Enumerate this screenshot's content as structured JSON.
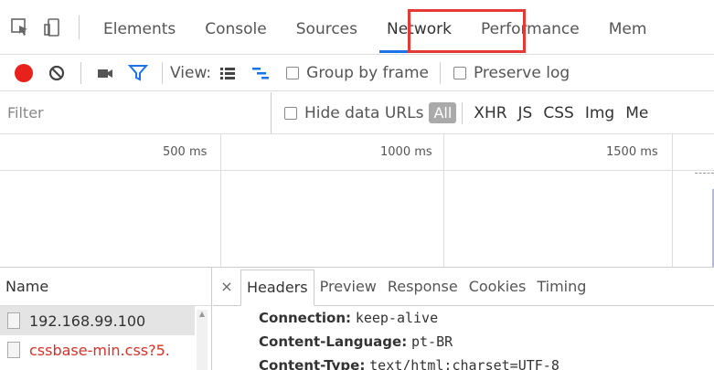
{
  "tabs": [
    "Elements",
    "Console",
    "Sources",
    "Network",
    "Performance",
    "Mem"
  ],
  "toolbar": {
    "view_label": "View:",
    "group_by_frame": "Group by frame",
    "preserve_log": "Preserve log"
  },
  "filterbar": {
    "filter_placeholder": "Filter",
    "hide_data_urls": "Hide data URLs",
    "all_label": "All",
    "types": [
      "XHR",
      "JS",
      "CSS",
      "Img",
      "Me"
    ]
  },
  "timeline": {
    "ticks": [
      "500 ms",
      "1000 ms",
      "1500 ms"
    ]
  },
  "requests": {
    "header": "Name",
    "items": [
      "192.168.99.100",
      "cssbase-min.css?5."
    ]
  },
  "details": {
    "close_label": "×",
    "tabs": [
      "Headers",
      "Preview",
      "Response",
      "Cookies",
      "Timing"
    ],
    "headers": [
      {
        "key": "Connection:",
        "value": "keep-alive"
      },
      {
        "key": "Content-Language:",
        "value": "pt-BR"
      },
      {
        "key": "Content-Type:",
        "value": "text/html;charset=UTF-8"
      }
    ]
  },
  "colors": {
    "accent": "#1a73e8",
    "highlight": "#e53935",
    "record": "#e8211c",
    "error_text": "#d93025"
  }
}
